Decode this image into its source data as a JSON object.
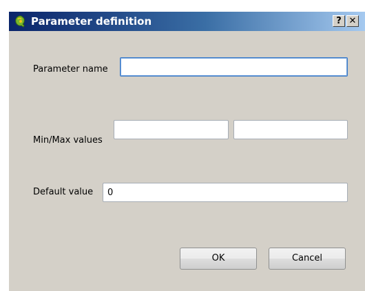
{
  "window": {
    "title": "Parameter definition",
    "help_label": "?",
    "close_label": "✕",
    "icon": "qgis-icon"
  },
  "form": {
    "name_label": "Parameter name",
    "name_value": "",
    "minmax_label": "Min/Max values",
    "min_value": "",
    "max_value": "",
    "default_label": "Default value",
    "default_value": "0"
  },
  "buttons": {
    "ok_label": "OK",
    "cancel_label": "Cancel"
  },
  "colors": {
    "titlebar_start": "#0a246a",
    "titlebar_end": "#a6caf0",
    "dialog_bg": "#d4d0c8",
    "focus_border": "#3d7bc7"
  }
}
